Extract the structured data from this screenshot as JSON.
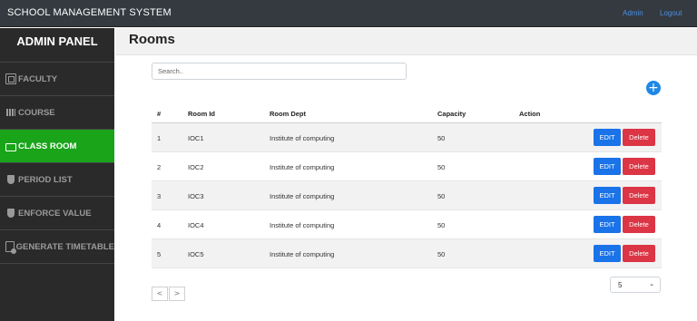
{
  "app": {
    "title": "SCHOOL MANAGEMENT SYSTEM",
    "nav": {
      "admin": "Admin",
      "logout": "Logout"
    }
  },
  "sidebar": {
    "title": "ADMIN PANEL",
    "items": [
      {
        "label": "FACULTY",
        "icon": "faculty-icon",
        "active": false
      },
      {
        "label": "COURSE",
        "icon": "course-icon",
        "active": false
      },
      {
        "label": "CLASS ROOM",
        "icon": "classroom-icon",
        "active": true
      },
      {
        "label": "PERIOD LIST",
        "icon": "shield-icon",
        "active": false
      },
      {
        "label": "ENFORCE VALUE",
        "icon": "shield-icon",
        "active": false
      },
      {
        "label": "GENERATE TIMETABLE",
        "icon": "calendar-icon",
        "active": false
      }
    ]
  },
  "main": {
    "title": "Rooms",
    "search": {
      "placeholder": "Search..",
      "value": ""
    },
    "add_label": "+",
    "table": {
      "headers": [
        "#",
        "Room Id",
        "Room Dept",
        "Capacity",
        "Action"
      ],
      "rows": [
        {
          "num": "1",
          "id": "IOC1",
          "dept": "Institute of computing",
          "capacity": "50"
        },
        {
          "num": "2",
          "id": "IOC2",
          "dept": "Institute of computing",
          "capacity": "50"
        },
        {
          "num": "3",
          "id": "IOC3",
          "dept": "Institute of computing",
          "capacity": "50"
        },
        {
          "num": "4",
          "id": "IOC4",
          "dept": "Institute of computing",
          "capacity": "50"
        },
        {
          "num": "5",
          "id": "IOC5",
          "dept": "Institute of computing",
          "capacity": "50"
        }
      ],
      "edit_label": "EDIT",
      "delete_label": "Delete"
    },
    "pagination": {
      "prev": "<",
      "next": ">",
      "page_size": "5"
    }
  },
  "colors": {
    "topbar": "#343a40",
    "sidebar": "#2a2a2a",
    "active": "#19a419",
    "edit": "#1a73e8",
    "delete": "#dc3545",
    "add": "#1e88e5"
  }
}
